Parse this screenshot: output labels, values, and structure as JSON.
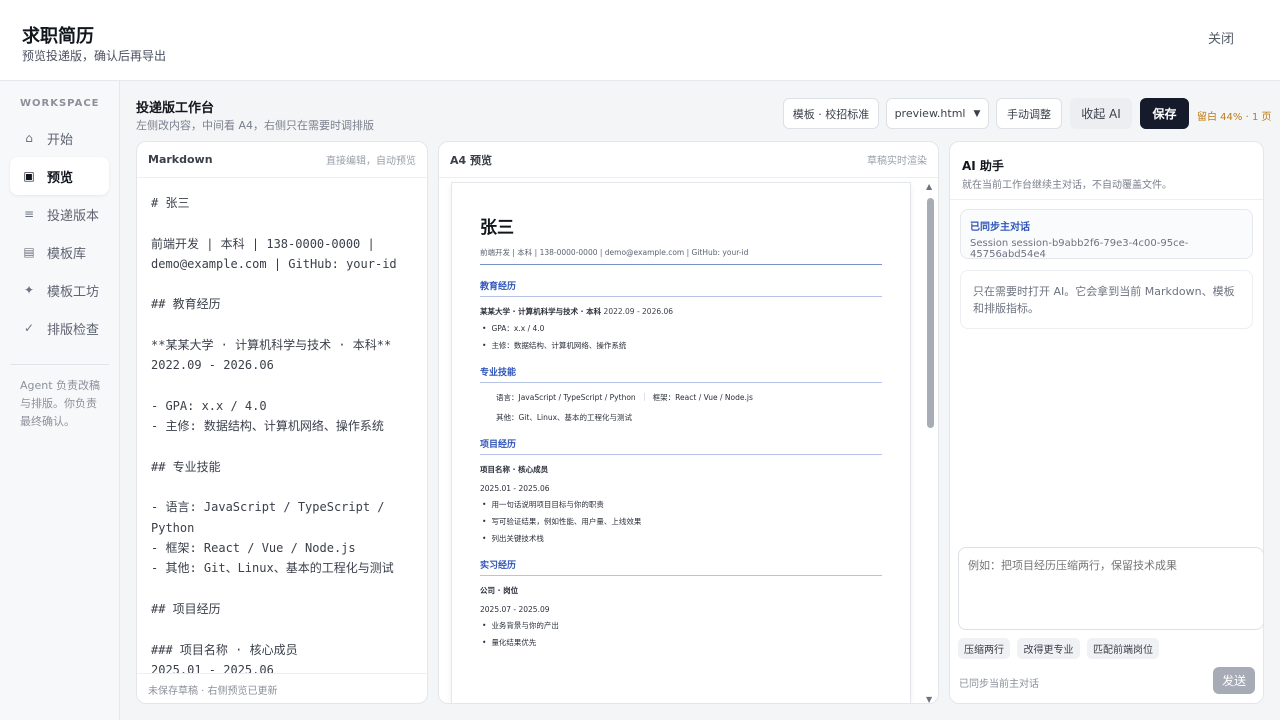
{
  "header": {
    "title": "求职简历",
    "subtitle": "预览投递版，确认后再导出",
    "close_label": "关闭"
  },
  "sidebar": {
    "section_label": "WORKSPACE",
    "items": [
      {
        "label": "开始",
        "icon": "home-icon",
        "glyph": "⌂",
        "active": false
      },
      {
        "label": "预览",
        "icon": "preview-icon",
        "glyph": "▣",
        "active": true
      },
      {
        "label": "投递版本",
        "icon": "list-icon",
        "glyph": "≡",
        "active": false
      },
      {
        "label": "模板库",
        "icon": "library-icon",
        "glyph": "▤",
        "active": false
      },
      {
        "label": "模板工坊",
        "icon": "sparkle-icon",
        "glyph": "✦",
        "active": false
      },
      {
        "label": "排版检查",
        "icon": "check-icon",
        "glyph": "✓",
        "active": false
      }
    ],
    "note": "Agent 负责改稿与排版。你负责最终确认。"
  },
  "workbench": {
    "title": "投递版工作台",
    "subtitle": "左侧改内容，中间看 A4，右侧只在需要时调排版"
  },
  "toolbar": {
    "template_label": "模板 · 校招标准",
    "file_select_value": "preview.html",
    "manual_adjust_label": "手动调整",
    "collapse_ai_label": "收起 AI",
    "save_label": "保存",
    "margin_info": "留白 44% · 1 页"
  },
  "markdown_panel": {
    "title": "Markdown",
    "hint": "直接编辑，自动预览",
    "content": "# 张三\n\n前端开发 | 本科 | 138-0000-0000 | demo@example.com | GitHub: your-id\n\n## 教育经历\n\n**某某大学 · 计算机科学与技术 · 本科** 2022.09 - 2026.06\n\n- GPA: x.x / 4.0\n- 主修: 数据结构、计算机网络、操作系统\n\n## 专业技能\n\n- 语言: JavaScript / TypeScript / Python\n- 框架: React / Vue / Node.js\n- 其他: Git、Linux、基本的工程化与测试\n\n## 项目经历\n\n### 项目名称 · 核心成员\n2025.01 - 2025.06",
    "footer": "未保存草稿 · 右侧预览已更新"
  },
  "preview_panel": {
    "title": "A4 预览",
    "hint": "草稿实时渲染",
    "resume": {
      "name": "张三",
      "contact": "前端开发 | 本科 | 138-0000-0000 | demo@example.com | GitHub: your-id",
      "education_heading": "教育经历",
      "education_school": "某某大学 · 计算机科学与技术 · 本科",
      "education_dates": "2022.09 - 2026.06",
      "education_bullets": [
        "GPA：x.x / 4.0",
        "主修：数据结构、计算机网络、操作系统"
      ],
      "skills_heading": "专业技能",
      "skill_lang": "语言：JavaScript / TypeScript / Python",
      "skill_framework": "框架：React / Vue / Node.js",
      "skill_other": "其他：Git、Linux、基本的工程化与测试",
      "projects_heading": "项目经历",
      "project_title": "项目名称 · 核心成员",
      "project_dates": "2025.01 - 2025.06",
      "project_bullets": [
        "用一句话说明项目目标与你的职责",
        "写可验证结果，例如性能、用户量、上线效果",
        "列出关键技术栈"
      ],
      "intern_heading": "实习经历",
      "intern_title": "公司 · 岗位",
      "intern_dates": "2025.07 - 2025.09",
      "intern_bullets": [
        "业务背景与你的产出",
        "量化结果优先"
      ]
    }
  },
  "ai_panel": {
    "title": "AI 助手",
    "subtitle": "就在当前工作台继续主对话，不自动覆盖文件。",
    "sync_title": "已同步主对话",
    "session_id": "Session session-b9abb2f6-79e3-4c00-95ce-45756abd54e4",
    "message": "只在需要时打开 AI。它会拿到当前 Markdown、模板和排版指标。",
    "input_placeholder": "例如：把项目经历压缩两行，保留技术成果",
    "chips": [
      "压缩两行",
      "改得更专业",
      "匹配前端岗位"
    ],
    "status": "已同步当前主对话",
    "send_label": "发送"
  }
}
